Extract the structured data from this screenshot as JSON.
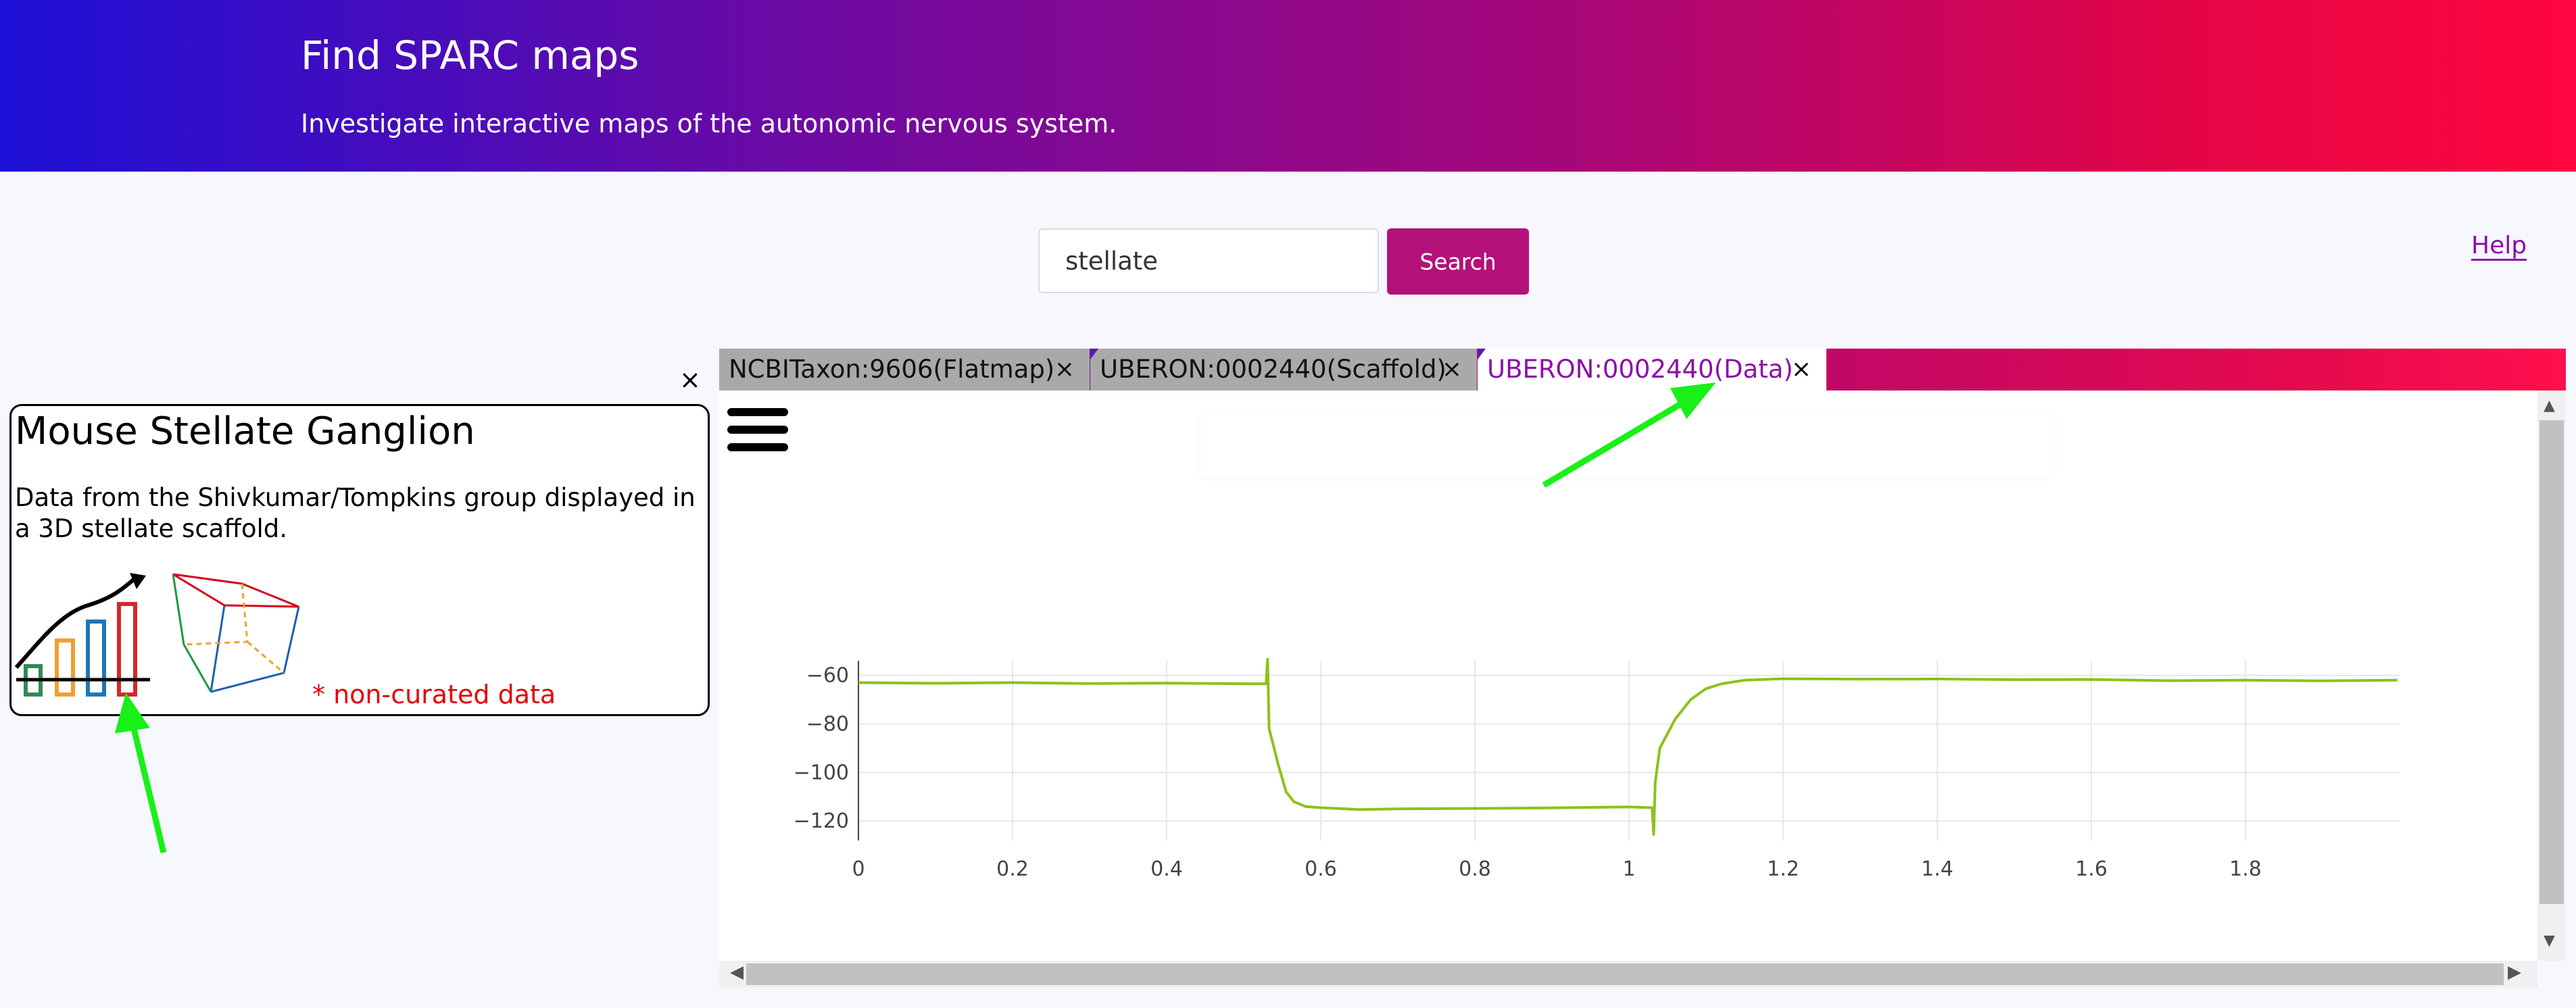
{
  "header": {
    "title": "Find SPARC maps",
    "subtitle": "Investigate interactive maps of the autonomic nervous system."
  },
  "search": {
    "value": "stellate",
    "button_label": "Search"
  },
  "help_link": "Help",
  "info_panel": {
    "close_label": "×",
    "title": "Mouse Stellate Ganglion",
    "description": "Data from the Shivkumar/Tompkins group displayed in a 3D stellate scaffold.",
    "note": "* non-curated data"
  },
  "tabs": [
    {
      "label": "NCBITaxon:9606(Flatmap)",
      "close": "×",
      "active": false
    },
    {
      "label": "UBERON:0002440(Scaffold)",
      "close": "×",
      "active": false
    },
    {
      "label": "UBERON:0002440(Data)",
      "close": "×",
      "active": true
    }
  ],
  "colors": {
    "header_gradient_start": "#1d0fd6",
    "header_gradient_end": "#ff063f",
    "search_button": "#b5117b",
    "active_tab_text": "#8b10a7",
    "trace": "#8cc21a",
    "annotation_arrow": "#18f018",
    "note_text": "#e40000"
  },
  "icons": {
    "menu": "hamburger-icon",
    "data_icon": "chart-thumbnail-icon",
    "scaffold_icon": "cube-scaffold-icon"
  },
  "chart_data": {
    "type": "line",
    "title": "",
    "xlabel": "",
    "ylabel": "",
    "xlim": [
      0,
      2
    ],
    "ylim": [
      -128,
      -54
    ],
    "x_ticks": [
      0,
      0.2,
      0.4,
      0.6,
      0.8,
      1,
      1.2,
      1.4,
      1.6,
      1.8
    ],
    "x_tick_labels": [
      "0",
      "0.2",
      "0.4",
      "0.6",
      "0.8",
      "1",
      "1.2",
      "1.4",
      "1.6",
      "1.8"
    ],
    "y_ticks": [
      -60,
      -80,
      -100,
      -120
    ],
    "y_tick_labels": [
      "−60",
      "−80",
      "−100",
      "−120"
    ],
    "grid": true,
    "series": [
      {
        "x": [
          0,
          0.1,
          0.2,
          0.3,
          0.4,
          0.5,
          0.529,
          0.531,
          0.533,
          0.545,
          0.555,
          0.565,
          0.58,
          0.6,
          0.65,
          0.7,
          0.8,
          0.9,
          1.0,
          1.03,
          1.032,
          1.034,
          1.04,
          1.06,
          1.08,
          1.1,
          1.12,
          1.15,
          1.2,
          1.3,
          1.4,
          1.5,
          1.6,
          1.7,
          1.8,
          1.9,
          1.997
        ],
        "y": [
          -63,
          -63.3,
          -63,
          -63.4,
          -63.2,
          -63.5,
          -63.5,
          -53,
          -82,
          -97,
          -108,
          -112,
          -114,
          -114.5,
          -115.3,
          -115,
          -114.8,
          -114.6,
          -114.2,
          -114.5,
          -125.5,
          -104,
          -90,
          -78,
          -70,
          -65.5,
          -63.5,
          -62,
          -61.4,
          -61.6,
          -61.5,
          -61.8,
          -61.7,
          -62.2,
          -62,
          -62.3,
          -62
        ]
      }
    ]
  }
}
